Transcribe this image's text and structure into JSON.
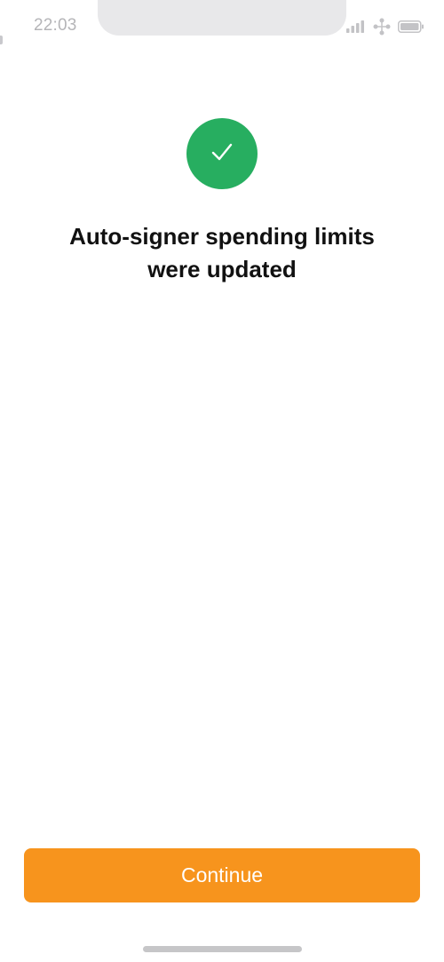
{
  "status_bar": {
    "time": "22:03",
    "icons": [
      "signal-icon",
      "network-icon",
      "battery-icon"
    ]
  },
  "success": {
    "icon": "checkmark-icon",
    "color": "#27ae60"
  },
  "title": {
    "line1": "Auto-signer spending limits",
    "line2": "were updated"
  },
  "continue_button": {
    "label": "Continue",
    "color": "#f7941d"
  }
}
